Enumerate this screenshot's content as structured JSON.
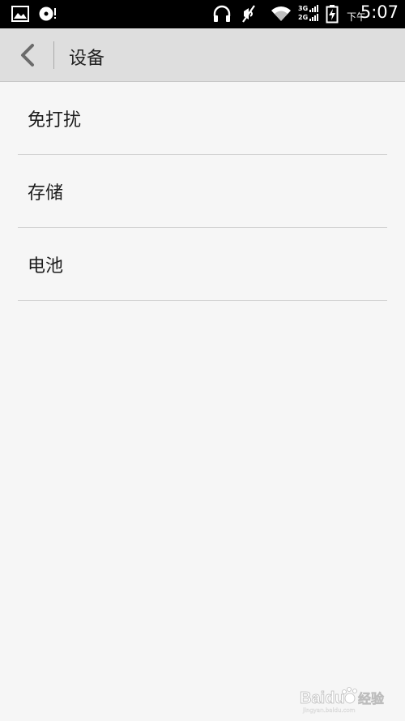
{
  "status_bar": {
    "time_prefix": "下午",
    "time": "5:07",
    "network_top": "3G",
    "network_bottom": "2G",
    "icons": [
      "image-icon",
      "media-disc-icon",
      "headphones-icon",
      "mute-icon",
      "wifi-icon",
      "signal-icon",
      "battery-charging-icon"
    ]
  },
  "action_bar": {
    "title": "设备",
    "back_icon": "back-arrow-icon"
  },
  "settings_list": {
    "items": [
      {
        "label": "免打扰"
      },
      {
        "label": "存储"
      },
      {
        "label": "电池"
      }
    ]
  },
  "watermark": {
    "brand": "Baidu",
    "suffix": "经验",
    "url": "jingyan.baidu.com"
  },
  "colors": {
    "status_bar_bg": "#000000",
    "action_bar_bg": "#dedede",
    "page_bg": "#f6f6f6",
    "divider": "#d4d4d4"
  }
}
